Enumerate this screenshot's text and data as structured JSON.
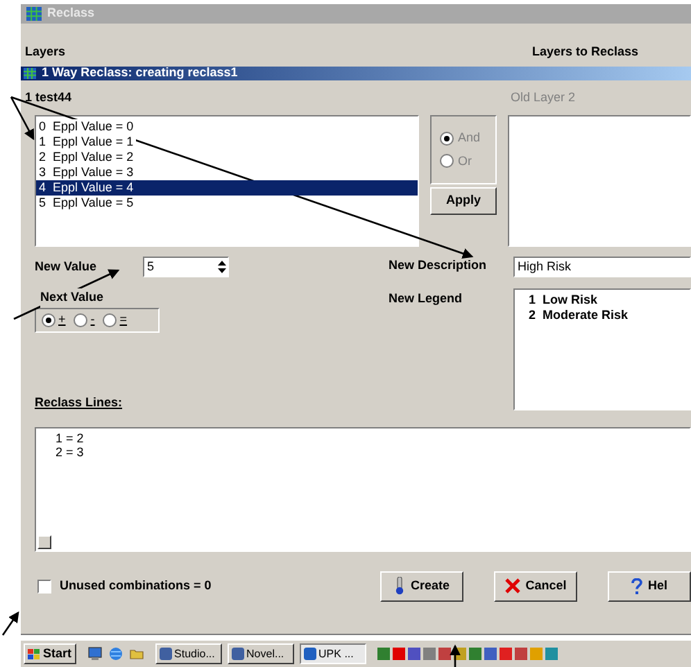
{
  "window": {
    "title": "Reclass"
  },
  "layers_label": "Layers",
  "layers_to_reclass_label": "Layers to Reclass",
  "active_layer_bar": "1 Way Reclass: creating reclass1",
  "source_layer": "1 test44",
  "old_layer": "Old Layer 2",
  "values": [
    {
      "label": "0  Eppl Value = 0",
      "selected": false
    },
    {
      "label": "1  Eppl Value = 1",
      "selected": false
    },
    {
      "label": "2  Eppl Value = 2",
      "selected": false
    },
    {
      "label": "3  Eppl Value = 3",
      "selected": false
    },
    {
      "label": "4  Eppl Value = 4",
      "selected": true
    },
    {
      "label": "5  Eppl Value = 5",
      "selected": false
    }
  ],
  "combine_options": [
    {
      "label": "And",
      "selected": true
    },
    {
      "label": "Or",
      "selected": false
    }
  ],
  "apply_button": "Apply",
  "new_value": {
    "label": "New Value",
    "value": "5"
  },
  "next_value": {
    "label": "Next Value",
    "options": [
      {
        "label": "+",
        "selected": true
      },
      {
        "label": "-",
        "selected": false
      },
      {
        "label": "=",
        "selected": false
      }
    ]
  },
  "new_description": {
    "label": "New Description",
    "value": "High Risk"
  },
  "new_legend": {
    "label": "New Legend",
    "items": [
      "1  Low Risk",
      "2  Moderate Risk"
    ]
  },
  "reclass_lines": {
    "label": "Reclass Lines:",
    "lines": [
      "1 = 2",
      "2 = 3"
    ]
  },
  "unused_combinations": {
    "label": "Unused combinations = 0",
    "checked": false
  },
  "buttons": [
    {
      "kind": "create",
      "label": "Create"
    },
    {
      "kind": "cancel",
      "label": "Cancel"
    },
    {
      "kind": "help",
      "label": "Hel"
    }
  ],
  "taskbar": {
    "start": "Start",
    "tasks": [
      {
        "label": "Studio...",
        "selected": false
      },
      {
        "label": "Novel...",
        "selected": false
      },
      {
        "label": "UPK ...",
        "selected": true
      }
    ]
  }
}
